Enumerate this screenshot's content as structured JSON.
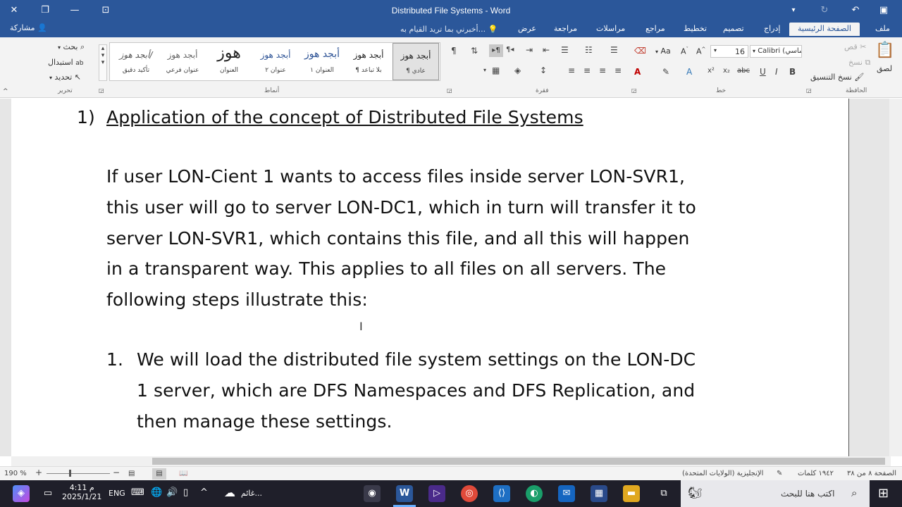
{
  "window": {
    "title": "Distributed File Systems - Word",
    "share_label": "مشاركة",
    "tell_me": "أخبرني بما تريد القيام به..."
  },
  "tabs": [
    {
      "label": "ملف"
    },
    {
      "label": "الصفحة الرئيسية"
    },
    {
      "label": "إدراج"
    },
    {
      "label": "تصميم"
    },
    {
      "label": "تخطيط"
    },
    {
      "label": "مراجع"
    },
    {
      "label": "مراسلات"
    },
    {
      "label": "مراجعة"
    },
    {
      "label": "عرض"
    }
  ],
  "ribbon": {
    "clipboard": {
      "label": "الحافظة",
      "paste": "لصق",
      "cut": "قص",
      "copy": "نسخ",
      "format_painter": "نسخ التنسيق"
    },
    "font": {
      "label": "خط",
      "font_name": "Calibri (أساسي",
      "font_size": "16"
    },
    "paragraph": {
      "label": "فقرة"
    },
    "styles": {
      "label": "أنماط",
      "items": [
        {
          "sample": "أبجد هوز",
          "name": "¶ عادي"
        },
        {
          "sample": "أبجد هوز",
          "name": "¶ بلا تباعد"
        },
        {
          "sample": "أبجد هوز",
          "name": "العنوان ١"
        },
        {
          "sample": "أبجد هوز",
          "name": "عنوان ٢"
        },
        {
          "sample": "هوز",
          "name": "العنوان"
        },
        {
          "sample": "أبجد هوز",
          "name": "عنوان فرعي"
        },
        {
          "sample": "أبجد هوز/",
          "name": "تأكيد دقيق"
        }
      ]
    },
    "editing": {
      "label": "تحرير",
      "find": "بحث",
      "replace": "استبدال",
      "select": "تحديد"
    }
  },
  "document": {
    "heading_number": "1)",
    "heading": "Application of the concept of Distributed File Systems",
    "paragraph_lines": [
      "If user LON-Cient 1 wants to access files inside server LON-SVR1,",
      "this user will go to server LON-DC1, which in turn will transfer it to",
      "server LON-SVR1, which contains this file, and all this will happen",
      "in a transparent way. This applies to all files on all servers. The",
      "following steps illustrate this:"
    ],
    "list_item_number": "1.",
    "list_item_lines": [
      "We will load the distributed file system settings on the LON-DC",
      "1 server, which are DFS Namespaces and DFS Replication, and",
      "then manage these settings."
    ]
  },
  "status": {
    "page": "الصفحة ٨ من ٣٨",
    "words": "١٩٤٢ كلمات",
    "language": "الإنجليزية (الولايات المتحدة)",
    "zoom": "190 %"
  },
  "taskbar": {
    "search_placeholder": "اكتب هنا للبحث",
    "weather": "غائم...",
    "language": "ENG",
    "time": "4:11 م",
    "date": "2025/1/21"
  }
}
